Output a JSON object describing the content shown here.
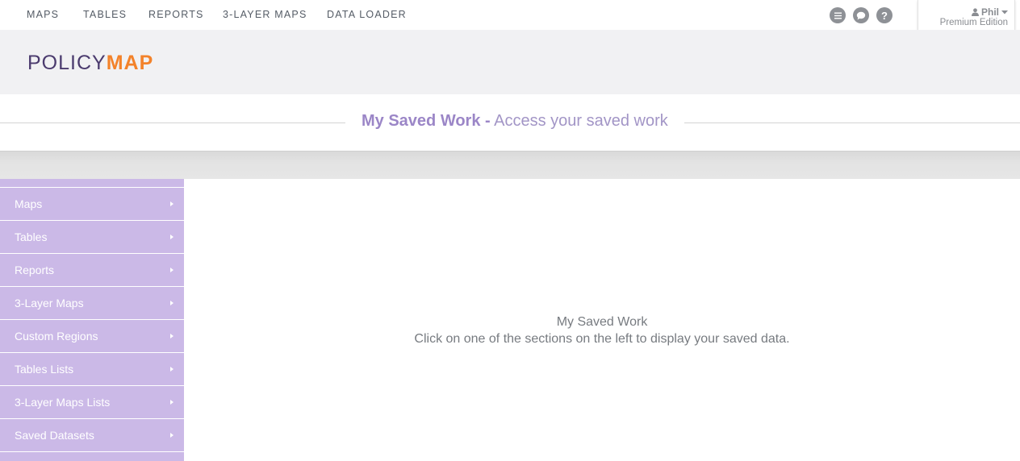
{
  "nav": {
    "items": [
      "MAPS",
      "TABLES",
      "REPORTS",
      "3-LAYER MAPS",
      "DATA LOADER"
    ],
    "icons": [
      "list-icon",
      "chat-icon",
      "help-icon"
    ]
  },
  "user": {
    "name": "Phil",
    "edition": "Premium Edition"
  },
  "logo": {
    "part1": "POLICY",
    "part2": "MAP",
    "colors": {
      "part1": "#4b3b6e",
      "part2": "#f3822a"
    }
  },
  "page": {
    "title_strong": "My Saved Work -",
    "title_light": "Access your saved work"
  },
  "sidebar": {
    "items": [
      {
        "label": "Maps"
      },
      {
        "label": "Tables"
      },
      {
        "label": "Reports"
      },
      {
        "label": "3-Layer Maps"
      },
      {
        "label": "Custom Regions"
      },
      {
        "label": "Tables Lists"
      },
      {
        "label": "3-Layer Maps Lists"
      },
      {
        "label": "Saved Datasets"
      }
    ]
  },
  "main": {
    "heading": "My Saved Work",
    "message": "Click on one of the sections on the left to display your saved data."
  },
  "colors": {
    "accent": "#9b86c7",
    "sidebar_bg": "#cbb9e7",
    "brand_orange": "#f3822a"
  }
}
